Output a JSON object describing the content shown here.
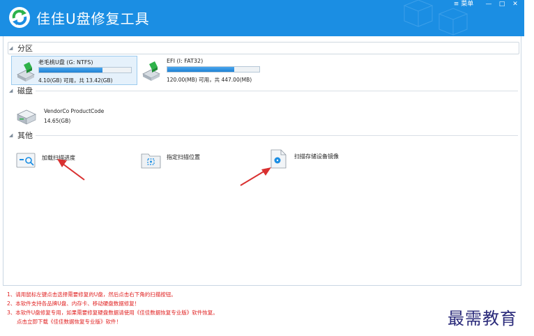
{
  "app": {
    "title": "佳佳U盘修复工具"
  },
  "window": {
    "menu_label": "≡ 菜单",
    "minimize": "—",
    "maximize": "□",
    "close": "✕"
  },
  "sections": {
    "partitions": "分区",
    "disks": "磁盘",
    "others": "其他"
  },
  "partitions": [
    {
      "name": "老毛桃U盘 (G: NTFS)",
      "info": "4.10(GB) 可用，共 13.42(GB)",
      "used_fraction": 0.69,
      "selected": true,
      "icon": "usb-drive-icon"
    },
    {
      "name": "EFI (I: FAT32)",
      "info": "120.00(MB) 可用，共 447.00(MB)",
      "used_fraction": 0.73,
      "selected": false,
      "icon": "usb-drive-icon"
    }
  ],
  "disk": {
    "name": "VendorCo ProductCode",
    "size": "14.65(GB)",
    "icon": "hard-disk-icon"
  },
  "tools": [
    {
      "label": "加载扫描进度",
      "icon": "load-scan-progress-icon"
    },
    {
      "label": "指定扫描位置",
      "icon": "folder-scan-icon"
    },
    {
      "label": "扫描存储设备镜像",
      "icon": "disk-image-icon"
    }
  ],
  "notes": [
    "1、请用鼠标左键点击选择需要修复的U盘，然后点击右下角的扫描按钮。",
    "2、本软件支持各品牌U盘、内存卡、移动硬盘数据修复！",
    "3、本软件U盘修复专用，如果需要修复硬盘数据请使用《佳佳数据恢复专业版》软件恢复。",
    "   点击立即下载《佳佳数据恢复专业版》软件！"
  ],
  "watermark": "最需教育",
  "colors": {
    "titlebar": "#1b8ee3",
    "bar_fill": "#1f82d4",
    "note_text": "#e02020",
    "annotation_arrow": "#d93030"
  }
}
